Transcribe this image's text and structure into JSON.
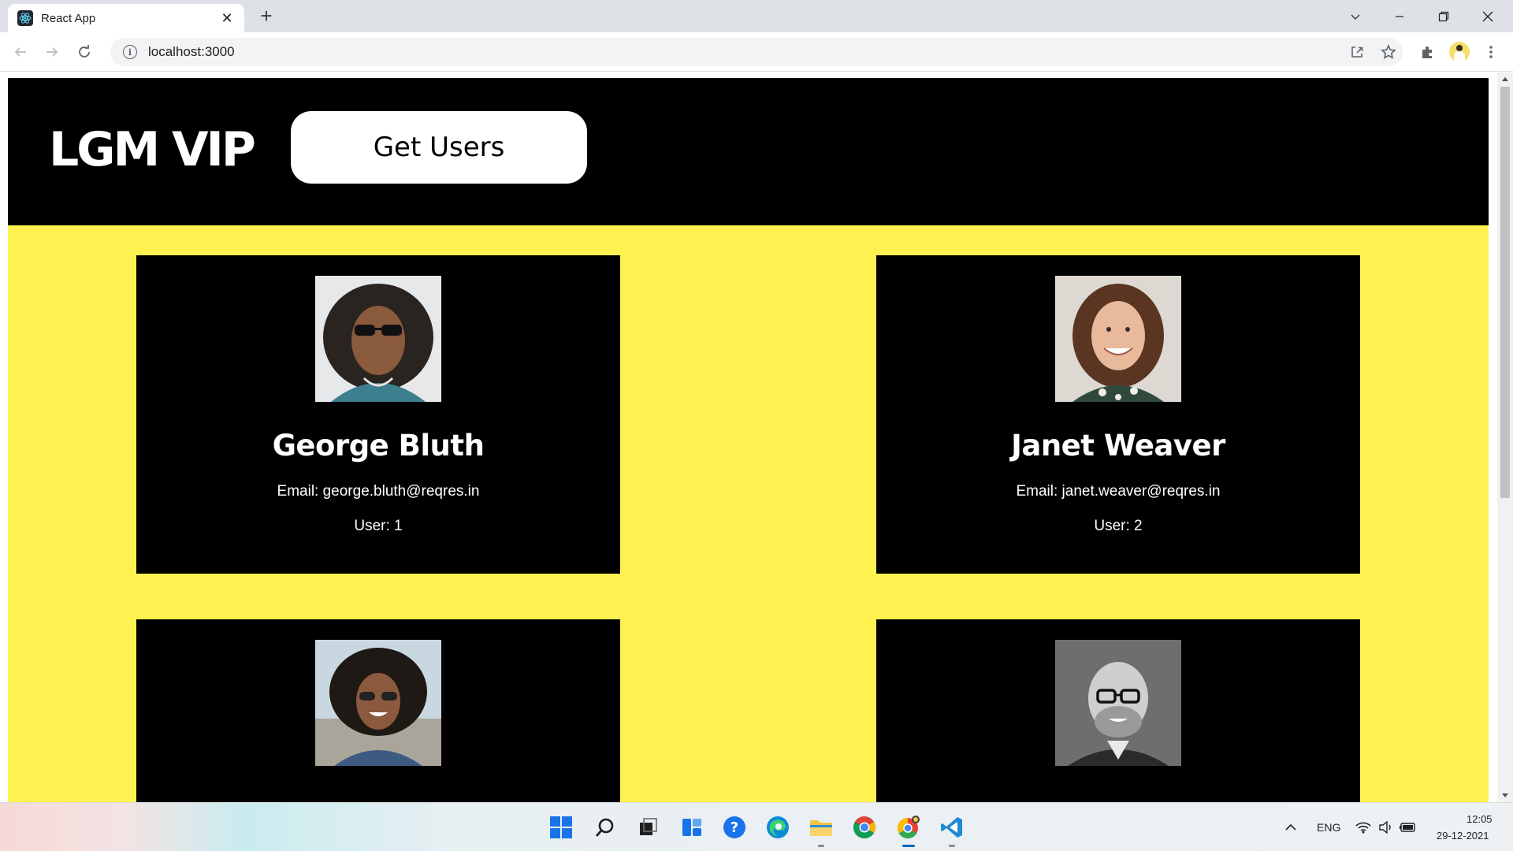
{
  "browser": {
    "tab_title": "React App",
    "url": "localhost:3000"
  },
  "app": {
    "brand": "LGM VIP",
    "get_users_label": "Get Users",
    "colors": {
      "header_bg": "#000000",
      "content_bg": "#fff150",
      "card_bg": "#000000",
      "text": "#ffffff"
    },
    "users": [
      {
        "name": "George Bluth",
        "email_line": "Email: george.bluth@reqres.in",
        "user_line": "User: 1",
        "photo": "man-long-curly-hair-sunglasses"
      },
      {
        "name": "Janet Weaver",
        "email_line": "Email: janet.weaver@reqres.in",
        "user_line": "User: 2",
        "photo": "woman-wavy-hair-smiling"
      },
      {
        "photo": "woman-curly-hair-sunglasses"
      },
      {
        "photo": "bald-man-glasses-grayscale"
      }
    ]
  },
  "taskbar": {
    "language": "ENG",
    "time": "12:05",
    "date": "29-12-2021",
    "apps": [
      "start-icon",
      "search-icon",
      "task-view-icon",
      "widgets-icon",
      "help-icon",
      "edge-icon",
      "file-explorer-icon",
      "chrome-icon",
      "chrome-canary-icon",
      "vscode-icon"
    ]
  }
}
